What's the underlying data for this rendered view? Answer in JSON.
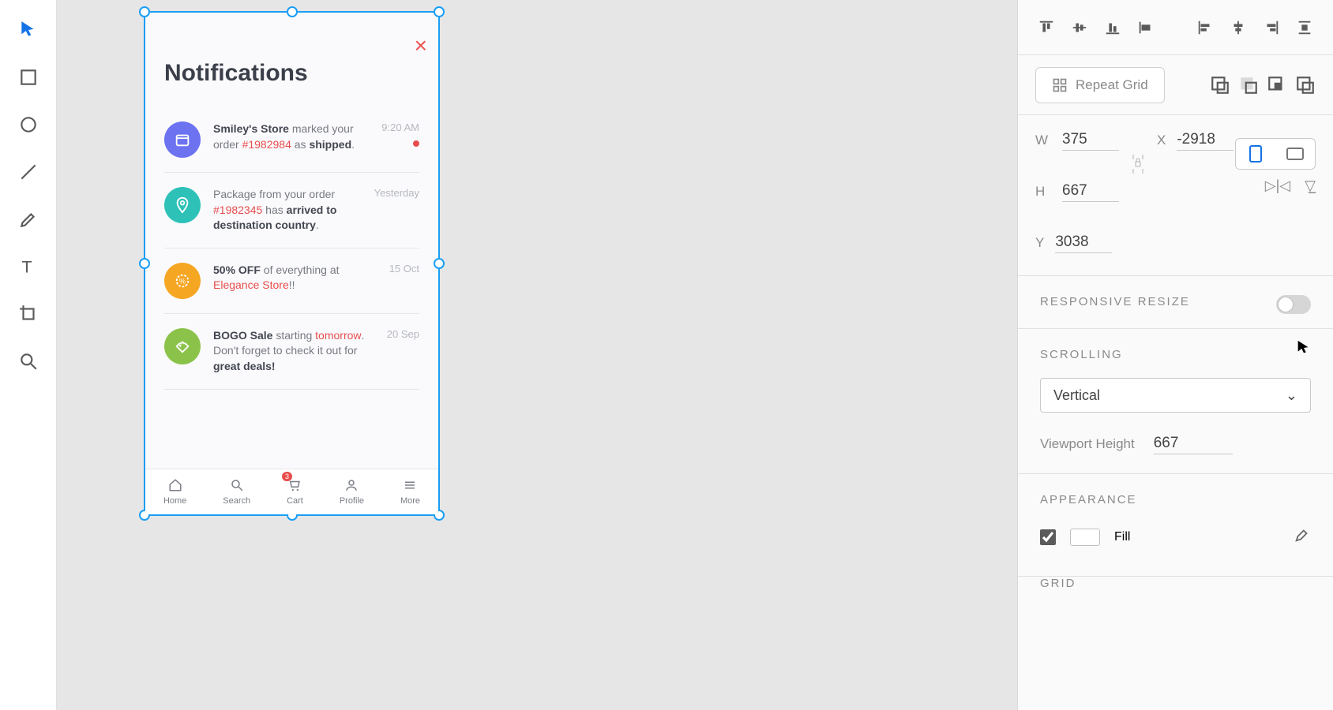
{
  "left_tools": [
    "select",
    "rectangle",
    "ellipse",
    "line",
    "pen",
    "text",
    "artboard",
    "zoom"
  ],
  "artboard": {
    "title": "Notifications",
    "close_glyph": "×",
    "notifications": [
      {
        "avatar": "purple",
        "time": "9:20 AM",
        "unread": true,
        "parts": [
          [
            "strong",
            "Smiley's Store"
          ],
          [
            "text",
            " marked your order "
          ],
          [
            "red",
            "#1982984"
          ],
          [
            "text",
            " as "
          ],
          [
            "strong",
            "shipped"
          ],
          [
            "text",
            "."
          ]
        ]
      },
      {
        "avatar": "teal",
        "time": "Yesterday",
        "unread": false,
        "parts": [
          [
            "text",
            "Package from your order "
          ],
          [
            "red",
            "#1982345"
          ],
          [
            "text",
            " has "
          ],
          [
            "strong",
            "arrived to destination country"
          ],
          [
            "text",
            "."
          ]
        ]
      },
      {
        "avatar": "orange",
        "time": "15 Oct",
        "unread": false,
        "parts": [
          [
            "strong",
            "50% OFF"
          ],
          [
            "text",
            " of everything at "
          ],
          [
            "red",
            "Elegance Store"
          ],
          [
            "text",
            "!!"
          ]
        ]
      },
      {
        "avatar": "green",
        "time": "20 Sep",
        "unread": false,
        "parts": [
          [
            "strong",
            "BOGO Sale"
          ],
          [
            "text",
            " starting "
          ],
          [
            "red",
            "tomorrow"
          ],
          [
            "text",
            ". Don't forget to check it out for "
          ],
          [
            "strong",
            "great deals!"
          ]
        ]
      }
    ],
    "tabs": [
      {
        "label": "Home",
        "icon": "home"
      },
      {
        "label": "Search",
        "icon": "search"
      },
      {
        "label": "Cart",
        "icon": "cart",
        "badge": "3"
      },
      {
        "label": "Profile",
        "icon": "profile"
      },
      {
        "label": "More",
        "icon": "more"
      }
    ]
  },
  "inspector": {
    "repeat_grid_label": "Repeat Grid",
    "dims": {
      "W_label": "W",
      "W": "375",
      "H_label": "H",
      "H": "667",
      "X_label": "X",
      "X": "-2918",
      "Y_label": "Y",
      "Y": "3038"
    },
    "responsive_label": "RESPONSIVE RESIZE",
    "scrolling_label": "SCROLLING",
    "scroll_value": "Vertical",
    "viewport_label": "Viewport Height",
    "viewport_value": "667",
    "appearance_label": "APPEARANCE",
    "fill_label": "Fill",
    "grid_label": "GRID"
  }
}
